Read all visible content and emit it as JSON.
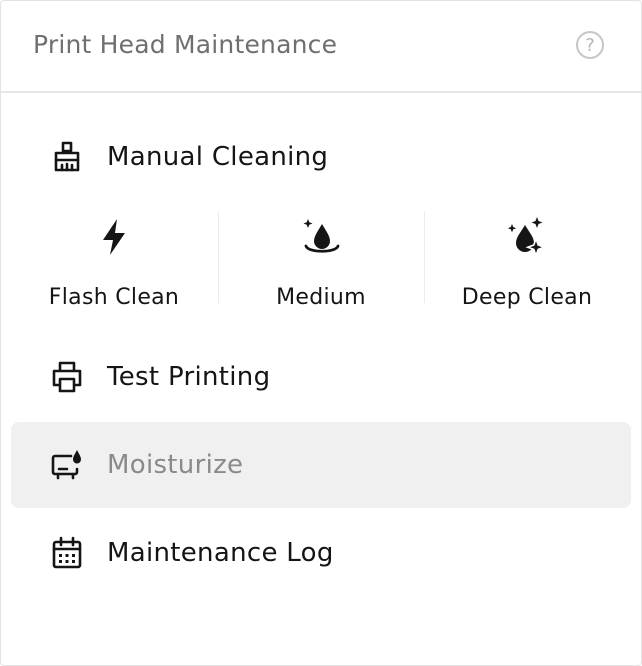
{
  "header": {
    "title": "Print Head Maintenance",
    "help_label": "?"
  },
  "menu": {
    "manual_cleaning": {
      "label": "Manual Cleaning",
      "icon": "brush-icon"
    },
    "cleaning_options": [
      {
        "label": "Flash Clean",
        "icon": "lightning-icon"
      },
      {
        "label": "Medium",
        "icon": "water-drop-icon"
      },
      {
        "label": "Deep Clean",
        "icon": "sparkle-drop-icon"
      }
    ],
    "test_printing": {
      "label": "Test Printing",
      "icon": "printer-icon"
    },
    "moisturize": {
      "label": "Moisturize",
      "icon": "moisturize-icon",
      "state": "selected"
    },
    "maintenance_log": {
      "label": "Maintenance Log",
      "icon": "calendar-icon"
    }
  },
  "colors": {
    "text_primary": "#151515",
    "text_muted": "#8a8a8a",
    "title_gray": "#6f6f6f",
    "selected_bg": "#f0f0f0",
    "border": "#e6e6e6"
  }
}
